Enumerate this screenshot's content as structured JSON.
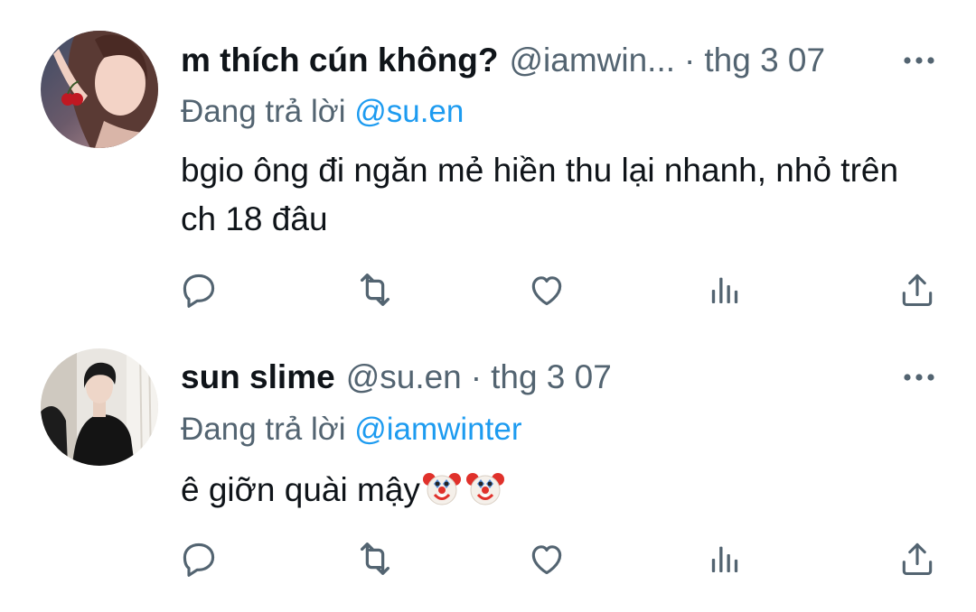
{
  "colors": {
    "text_primary": "#0f1419",
    "text_secondary": "#536471",
    "link": "#1d9bf0",
    "background": "#ffffff"
  },
  "tweets": [
    {
      "display_name": "m thích cún không?",
      "handle": "@iamwin...",
      "separator": "·",
      "timestamp": "thg 3 07",
      "reply_prefix": "Đang trả lời",
      "reply_to": "@su.en",
      "text": "bgio ông đi ngăn mẻ hiền thu lại nhanh, nhỏ trên ch 18 đâu",
      "emojis": [],
      "avatar_icon": "avatar-girl-cherry"
    },
    {
      "display_name": "sun slime",
      "handle": "@su.en",
      "separator": "·",
      "timestamp": "thg 3 07",
      "reply_prefix": "Đang trả lời",
      "reply_to": "@iamwinter",
      "text": "ê giỡn quài mậy",
      "emojis": [
        "clown-face",
        "clown-face"
      ],
      "avatar_icon": "avatar-man-dark-coat"
    }
  ],
  "action_icons": [
    "reply-icon",
    "retweet-icon",
    "like-icon",
    "views-icon",
    "share-icon"
  ],
  "more_icon": "more-horizontal-icon"
}
